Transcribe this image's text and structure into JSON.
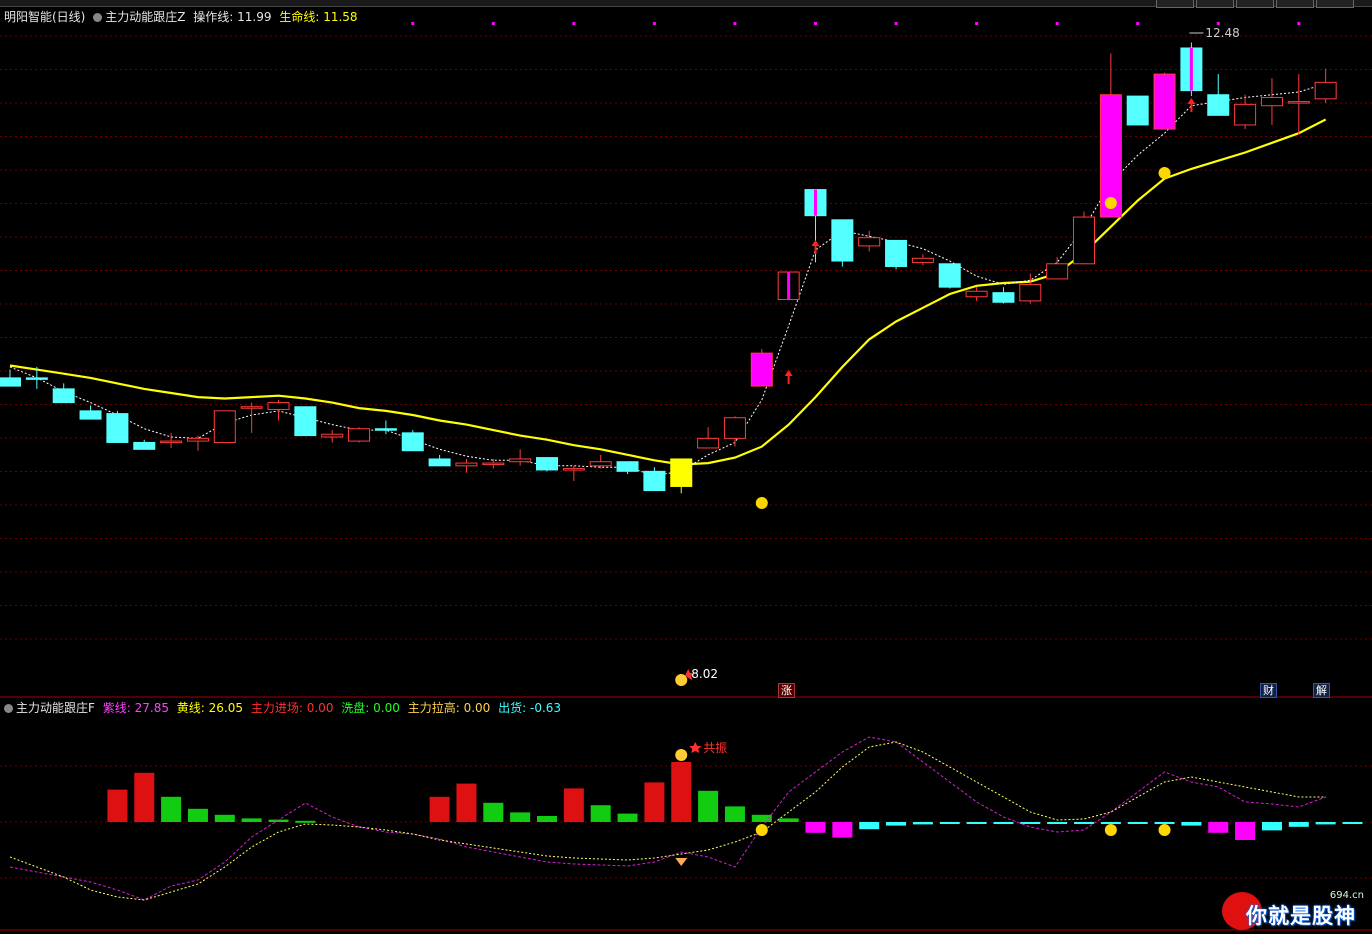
{
  "main_legend": {
    "stock": "明阳智能(日线)",
    "indicator": "主力动能跟庄Z",
    "op_label": "操作线:",
    "op_value": "11.99",
    "life_label": "生命线:",
    "life_value": "11.58"
  },
  "sub_legend": {
    "indicator": "主力动能跟庄F",
    "purple_label": "紫线:",
    "purple_value": "27.85",
    "yellow_label": "黄线:",
    "yellow_value": "26.05",
    "enter_label": "主力进场:",
    "enter_value": "0.00",
    "wash_label": "洗盘:",
    "wash_value": "0.00",
    "lift_label": "主力拉高:",
    "lift_value": "0.00",
    "ship_label": "出货:",
    "ship_value": "-0.63"
  },
  "tags": {
    "zhang": "涨",
    "cai": "财",
    "jie": "解"
  },
  "annotations": {
    "low_price": "8.02",
    "high_price": "12.48",
    "resonance": "共振"
  },
  "watermark": {
    "text": "你就是股神",
    "site": "694.cn"
  },
  "colors": {
    "up_candle": "#ff3c3c",
    "down_candle": "#54ffff",
    "signal_candle": "#ff00ff",
    "life_line": "#ffff00",
    "op_line": "#ffffff",
    "grid": "#6e0000",
    "bar_red": "#dd1111",
    "bar_green": "#11cc11",
    "bar_magenta": "#ff00ff",
    "bar_cyan": "#33ffff",
    "purple_line": "#d020d0",
    "yellow_dot_line": "#ffff66"
  },
  "chart_data": {
    "type": "candlestick",
    "price_range": [
      7.9,
      12.6
    ],
    "candles": [
      {
        "o": 10.04,
        "h": 10.1,
        "l": 9.98,
        "c": 9.98,
        "sig": ""
      },
      {
        "o": 10.04,
        "h": 10.12,
        "l": 9.96,
        "c": 10.03,
        "sig": ""
      },
      {
        "o": 9.96,
        "h": 10.0,
        "l": 9.86,
        "c": 9.86,
        "sig": ""
      },
      {
        "o": 9.8,
        "h": 9.84,
        "l": 9.74,
        "c": 9.74,
        "sig": ""
      },
      {
        "o": 9.78,
        "h": 9.8,
        "l": 9.57,
        "c": 9.57,
        "sig": ""
      },
      {
        "o": 9.57,
        "h": 9.59,
        "l": 9.53,
        "c": 9.52,
        "sig": ""
      },
      {
        "o": 9.58,
        "h": 9.64,
        "l": 9.53,
        "c": 9.58,
        "sig": ""
      },
      {
        "o": 9.58,
        "h": 9.62,
        "l": 9.51,
        "c": 9.6,
        "sig": ""
      },
      {
        "o": 9.57,
        "h": 9.8,
        "l": 9.57,
        "c": 9.8,
        "sig": ""
      },
      {
        "o": 9.82,
        "h": 9.86,
        "l": 9.64,
        "c": 9.83,
        "sig": ""
      },
      {
        "o": 9.81,
        "h": 9.88,
        "l": 9.73,
        "c": 9.86,
        "sig": ""
      },
      {
        "o": 9.83,
        "h": 9.83,
        "l": 9.62,
        "c": 9.62,
        "sig": ""
      },
      {
        "o": 9.61,
        "h": 9.66,
        "l": 9.57,
        "c": 9.63,
        "sig": ""
      },
      {
        "o": 9.58,
        "h": 9.68,
        "l": 9.57,
        "c": 9.67,
        "sig": ""
      },
      {
        "o": 9.67,
        "h": 9.73,
        "l": 9.63,
        "c": 9.66,
        "sig": ""
      },
      {
        "o": 9.64,
        "h": 9.66,
        "l": 9.51,
        "c": 9.51,
        "sig": ""
      },
      {
        "o": 9.45,
        "h": 9.48,
        "l": 9.4,
        "c": 9.4,
        "sig": ""
      },
      {
        "o": 9.4,
        "h": 9.45,
        "l": 9.35,
        "c": 9.42,
        "sig": ""
      },
      {
        "o": 9.41,
        "h": 9.45,
        "l": 9.38,
        "c": 9.42,
        "sig": ""
      },
      {
        "o": 9.43,
        "h": 9.52,
        "l": 9.4,
        "c": 9.45,
        "sig": ""
      },
      {
        "o": 9.46,
        "h": 9.46,
        "l": 9.36,
        "c": 9.37,
        "sig": ""
      },
      {
        "o": 9.37,
        "h": 9.4,
        "l": 9.29,
        "c": 9.38,
        "sig": ""
      },
      {
        "o": 9.4,
        "h": 9.48,
        "l": 9.38,
        "c": 9.43,
        "sig": ""
      },
      {
        "o": 9.43,
        "h": 9.43,
        "l": 9.34,
        "c": 9.36,
        "sig": ""
      },
      {
        "o": 9.36,
        "h": 9.39,
        "l": 9.22,
        "c": 9.22,
        "sig": ""
      },
      {
        "o": 9.45,
        "h": 9.45,
        "l": 9.2,
        "c": 9.25,
        "sig": "yellow"
      },
      {
        "o": 9.53,
        "h": 9.68,
        "l": 9.53,
        "c": 9.6,
        "sig": ""
      },
      {
        "o": 9.6,
        "h": 9.76,
        "l": 9.54,
        "c": 9.75,
        "sig": ""
      },
      {
        "o": 9.98,
        "h": 10.25,
        "l": 9.98,
        "c": 10.22,
        "sig": "magenta"
      },
      {
        "o": 10.61,
        "h": 10.81,
        "l": 10.61,
        "c": 10.81,
        "sig": "magenta_up"
      },
      {
        "o": 11.41,
        "h": 11.41,
        "l": 10.88,
        "c": 11.22,
        "sig": "cyan_magenta"
      },
      {
        "o": 11.19,
        "h": 11.19,
        "l": 10.85,
        "c": 10.89,
        "sig": ""
      },
      {
        "o": 11.0,
        "h": 11.11,
        "l": 10.96,
        "c": 11.06,
        "sig": ""
      },
      {
        "o": 11.04,
        "h": 11.04,
        "l": 10.83,
        "c": 10.85,
        "sig": ""
      },
      {
        "o": 10.88,
        "h": 10.94,
        "l": 10.86,
        "c": 10.91,
        "sig": ""
      },
      {
        "o": 10.87,
        "h": 10.87,
        "l": 10.69,
        "c": 10.7,
        "sig": ""
      },
      {
        "o": 10.63,
        "h": 10.7,
        "l": 10.6,
        "c": 10.67,
        "sig": ""
      },
      {
        "o": 10.66,
        "h": 10.7,
        "l": 10.58,
        "c": 10.59,
        "sig": ""
      },
      {
        "o": 10.6,
        "h": 10.8,
        "l": 10.58,
        "c": 10.72,
        "sig": ""
      },
      {
        "o": 10.76,
        "h": 10.92,
        "l": 10.76,
        "c": 10.87,
        "sig": ""
      },
      {
        "o": 10.87,
        "h": 11.25,
        "l": 10.87,
        "c": 11.21,
        "sig": ""
      },
      {
        "o": 11.21,
        "h": 12.4,
        "l": 11.21,
        "c": 12.1,
        "sig": "magenta"
      },
      {
        "o": 12.09,
        "h": 12.09,
        "l": 11.88,
        "c": 11.88,
        "sig": ""
      },
      {
        "o": 11.85,
        "h": 12.26,
        "l": 11.85,
        "c": 12.25,
        "sig": "magenta"
      },
      {
        "o": 12.44,
        "h": 12.48,
        "l": 12.09,
        "c": 12.13,
        "sig": "cyan_magenta"
      },
      {
        "o": 12.1,
        "h": 12.25,
        "l": 11.95,
        "c": 11.95,
        "sig": ""
      },
      {
        "o": 11.88,
        "h": 12.1,
        "l": 11.85,
        "c": 12.03,
        "sig": ""
      },
      {
        "o": 12.02,
        "h": 12.22,
        "l": 11.88,
        "c": 12.08,
        "sig": ""
      },
      {
        "o": 12.05,
        "h": 12.25,
        "l": 11.81,
        "c": 12.05,
        "sig": ""
      },
      {
        "o": 12.07,
        "h": 12.29,
        "l": 12.04,
        "c": 12.19,
        "sig": ""
      }
    ],
    "life_line": [
      10.13,
      10.1,
      10.07,
      10.04,
      10.0,
      9.96,
      9.93,
      9.9,
      9.89,
      9.9,
      9.91,
      9.89,
      9.86,
      9.82,
      9.8,
      9.77,
      9.73,
      9.7,
      9.66,
      9.62,
      9.59,
      9.55,
      9.52,
      9.48,
      9.44,
      9.41,
      9.42,
      9.46,
      9.54,
      9.7,
      9.9,
      10.12,
      10.32,
      10.45,
      10.55,
      10.65,
      10.71,
      10.73,
      10.74,
      10.8,
      10.95,
      11.14,
      11.33,
      11.49,
      11.56,
      11.62,
      11.68,
      11.75,
      11.82,
      11.92
    ],
    "op_line": [
      10.12,
      10.04,
      9.94,
      9.86,
      9.77,
      9.67,
      9.61,
      9.6,
      9.71,
      9.77,
      9.8,
      9.75,
      9.7,
      9.66,
      9.66,
      9.59,
      9.52,
      9.47,
      9.44,
      9.44,
      9.4,
      9.4,
      9.39,
      9.39,
      9.33,
      9.36,
      9.48,
      9.57,
      9.88,
      10.42,
      10.97,
      11.11,
      11.07,
      11.03,
      10.98,
      10.89,
      10.78,
      10.72,
      10.75,
      10.88,
      11.13,
      11.46,
      11.66,
      11.82,
      12.02,
      12.05,
      12.08,
      12.1,
      12.12,
      12.18
    ],
    "sub_range": [
      -50,
      50
    ],
    "sub_bars": [
      {
        "v": 0,
        "t": "red"
      },
      {
        "v": 0,
        "t": "red"
      },
      {
        "v": 0,
        "t": "red"
      },
      {
        "v": 0,
        "t": "red"
      },
      {
        "v": 27,
        "t": "red"
      },
      {
        "v": 41,
        "t": "red"
      },
      {
        "v": 21,
        "t": "green"
      },
      {
        "v": 11,
        "t": "green"
      },
      {
        "v": 6,
        "t": "green"
      },
      {
        "v": 3,
        "t": "green"
      },
      {
        "v": 2,
        "t": "green"
      },
      {
        "v": 1,
        "t": "green"
      },
      {
        "v": 0,
        "t": "green"
      },
      {
        "v": 0,
        "t": "green"
      },
      {
        "v": 0,
        "t": "green"
      },
      {
        "v": 0,
        "t": "green"
      },
      {
        "v": 21,
        "t": "red"
      },
      {
        "v": 32,
        "t": "red"
      },
      {
        "v": 16,
        "t": "green"
      },
      {
        "v": 8,
        "t": "green"
      },
      {
        "v": 5,
        "t": "green"
      },
      {
        "v": 28,
        "t": "red"
      },
      {
        "v": 14,
        "t": "green"
      },
      {
        "v": 7,
        "t": "green"
      },
      {
        "v": 33,
        "t": "red"
      },
      {
        "v": 50,
        "t": "red"
      },
      {
        "v": 26,
        "t": "green"
      },
      {
        "v": 13,
        "t": "green"
      },
      {
        "v": 6,
        "t": "green"
      },
      {
        "v": 3,
        "t": "green"
      },
      {
        "v": -9,
        "t": "magenta"
      },
      {
        "v": -13,
        "t": "magenta"
      },
      {
        "v": -6,
        "t": "cyan"
      },
      {
        "v": -3,
        "t": "cyan"
      },
      {
        "v": -2,
        "t": "cyan"
      },
      {
        "v": -1,
        "t": "cyan"
      },
      {
        "v": -1,
        "t": "cyan"
      },
      {
        "v": -1,
        "t": "cyan"
      },
      {
        "v": -1,
        "t": "cyan"
      },
      {
        "v": -1,
        "t": "cyan"
      },
      {
        "v": -1,
        "t": "cyan"
      },
      {
        "v": -1,
        "t": "cyan"
      },
      {
        "v": -1,
        "t": "cyan"
      },
      {
        "v": -1,
        "t": "cyan"
      },
      {
        "v": -3,
        "t": "cyan"
      },
      {
        "v": -9,
        "t": "magenta"
      },
      {
        "v": -15,
        "t": "magenta"
      },
      {
        "v": -7,
        "t": "cyan"
      },
      {
        "v": -4,
        "t": "cyan"
      },
      {
        "v": -2,
        "t": "cyan"
      },
      {
        "v": -1,
        "t": "cyan"
      }
    ],
    "purple_line": [
      -45,
      -50,
      -55,
      -60,
      -68,
      -78,
      -64,
      -58,
      -40,
      -15,
      2,
      19,
      5,
      -5,
      -10,
      -12,
      -17,
      -25,
      -30,
      -35,
      -40,
      -42,
      -43,
      -44,
      -40,
      -30,
      -35,
      -45,
      -5,
      30,
      50,
      70,
      85,
      80,
      60,
      40,
      20,
      5,
      -5,
      -10,
      -8,
      10,
      30,
      50,
      40,
      35,
      20,
      18,
      15,
      25
    ],
    "yellow_line": [
      -35,
      -45,
      -55,
      -68,
      -75,
      -78,
      -70,
      -62,
      -45,
      -25,
      -10,
      -2,
      -3,
      -5,
      -8,
      -12,
      -18,
      -22,
      -26,
      -30,
      -34,
      -36,
      -37,
      -38,
      -36,
      -32,
      -28,
      -20,
      -10,
      10,
      30,
      55,
      75,
      80,
      70,
      55,
      40,
      25,
      10,
      2,
      3,
      10,
      25,
      40,
      45,
      40,
      35,
      30,
      25,
      25
    ]
  }
}
